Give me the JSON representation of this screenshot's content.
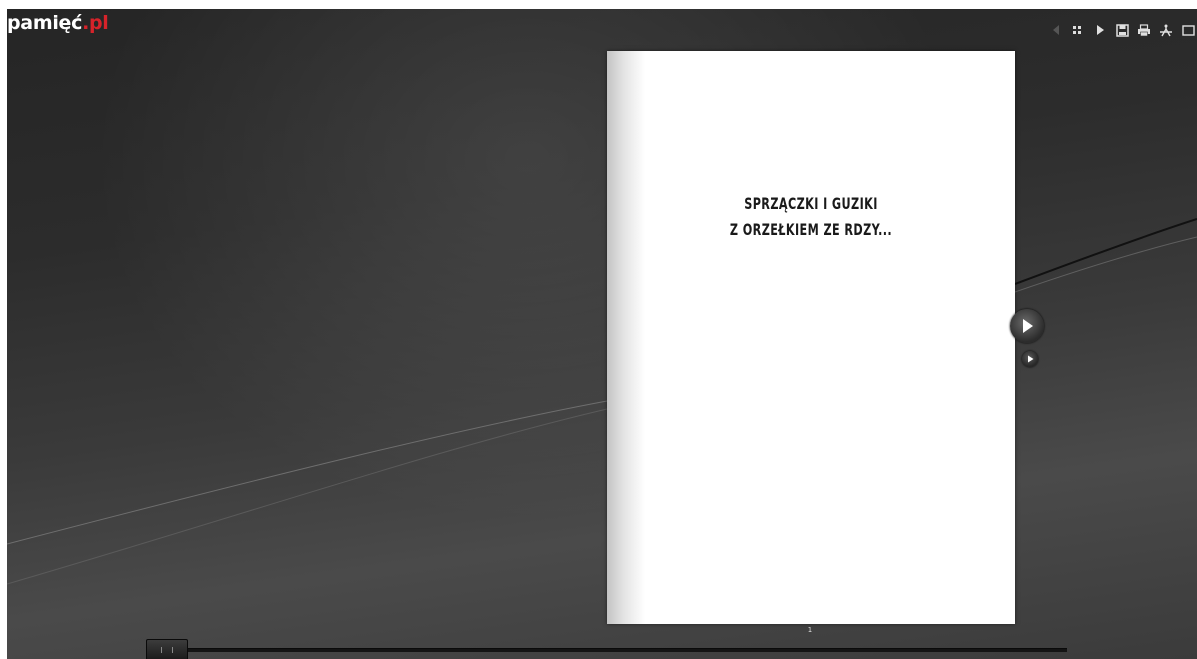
{
  "logo": {
    "main": "pamięć",
    "accent": ".pl"
  },
  "toolbar": {
    "buttons": [
      {
        "name": "prev-arrow-icon"
      },
      {
        "name": "grid-thumbnails-icon"
      },
      {
        "name": "play-icon"
      },
      {
        "name": "save-icon"
      },
      {
        "name": "print-icon"
      },
      {
        "name": "share-icon"
      },
      {
        "name": "fullscreen-icon"
      }
    ]
  },
  "page": {
    "title_line1": "SPRZĄCZKI I GUZIKI",
    "title_line2": "Z ORZEŁKIEM ZE RDZY...",
    "number": "1"
  },
  "navigation": {
    "next_page_icon": "next-page-icon",
    "last_page_icon": "last-page-icon"
  },
  "colors": {
    "brand_accent": "#d6232a",
    "background": "#2c2c2c",
    "page": "#ffffff"
  }
}
